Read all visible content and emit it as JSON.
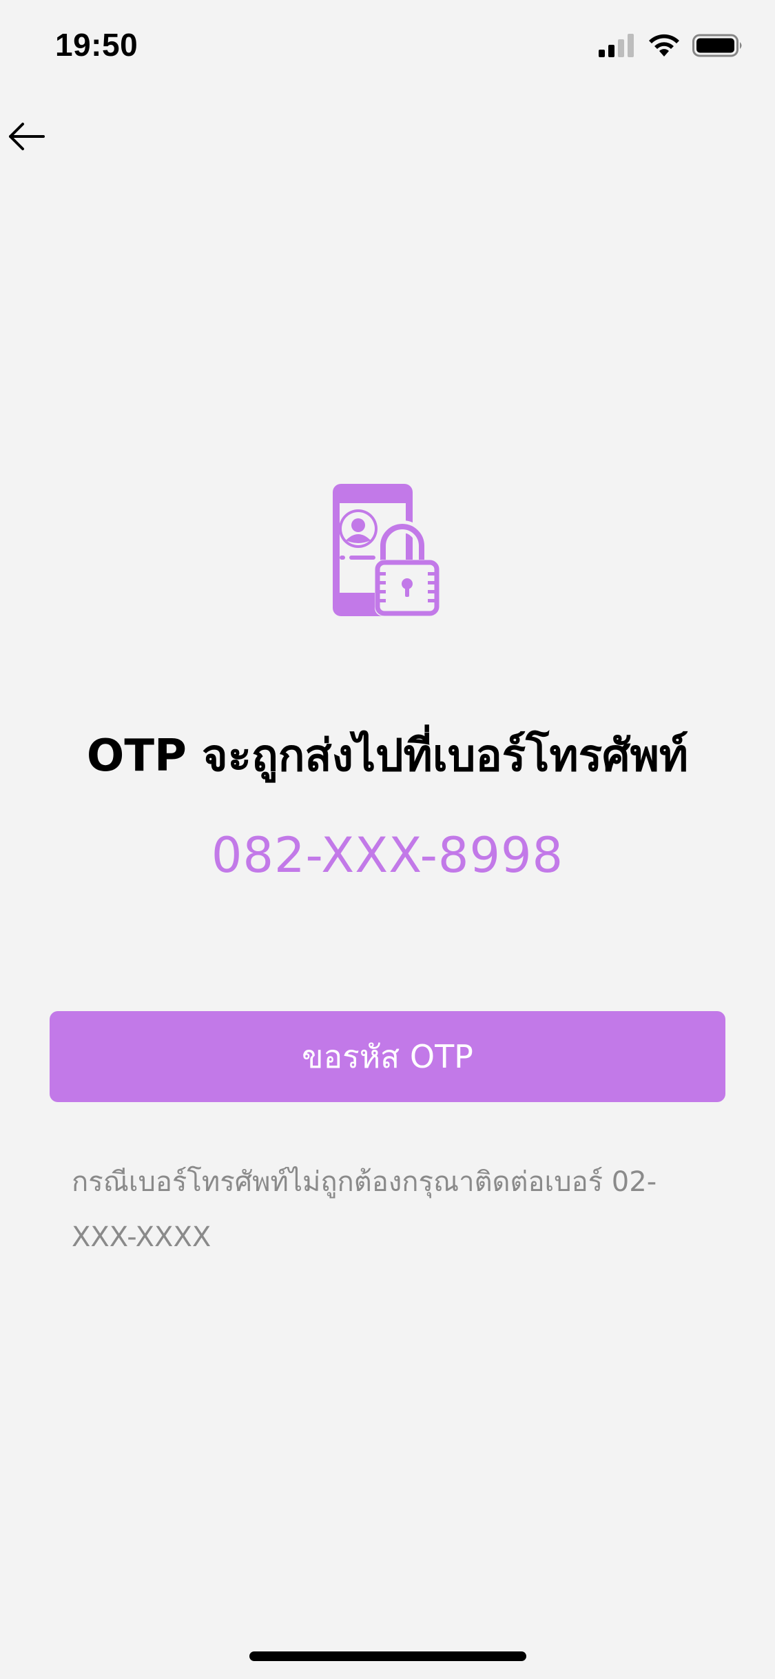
{
  "status_bar": {
    "time": "19:50",
    "icons": [
      "signal-icon",
      "wifi-icon",
      "battery-icon"
    ]
  },
  "nav": {
    "back_icon": "arrow-left-icon"
  },
  "illustration": {
    "icon": "phone-lock-icon",
    "color": "#c279e8"
  },
  "content": {
    "headline": "OTP จะถูกส่งไปที่เบอร์โทรศัพท์",
    "phone_number": "082-XXX-8998",
    "request_button_label": "ขอรหัส OTP",
    "note": "กรณีเบอร์โทรศัพท์ไม่ถูกต้องกรุณาติดต่อเบอร์ 02-XXX-XXXX"
  },
  "colors": {
    "accent": "#c279e8",
    "background": "#f3f3f3",
    "note_text": "#8a8a8a"
  }
}
